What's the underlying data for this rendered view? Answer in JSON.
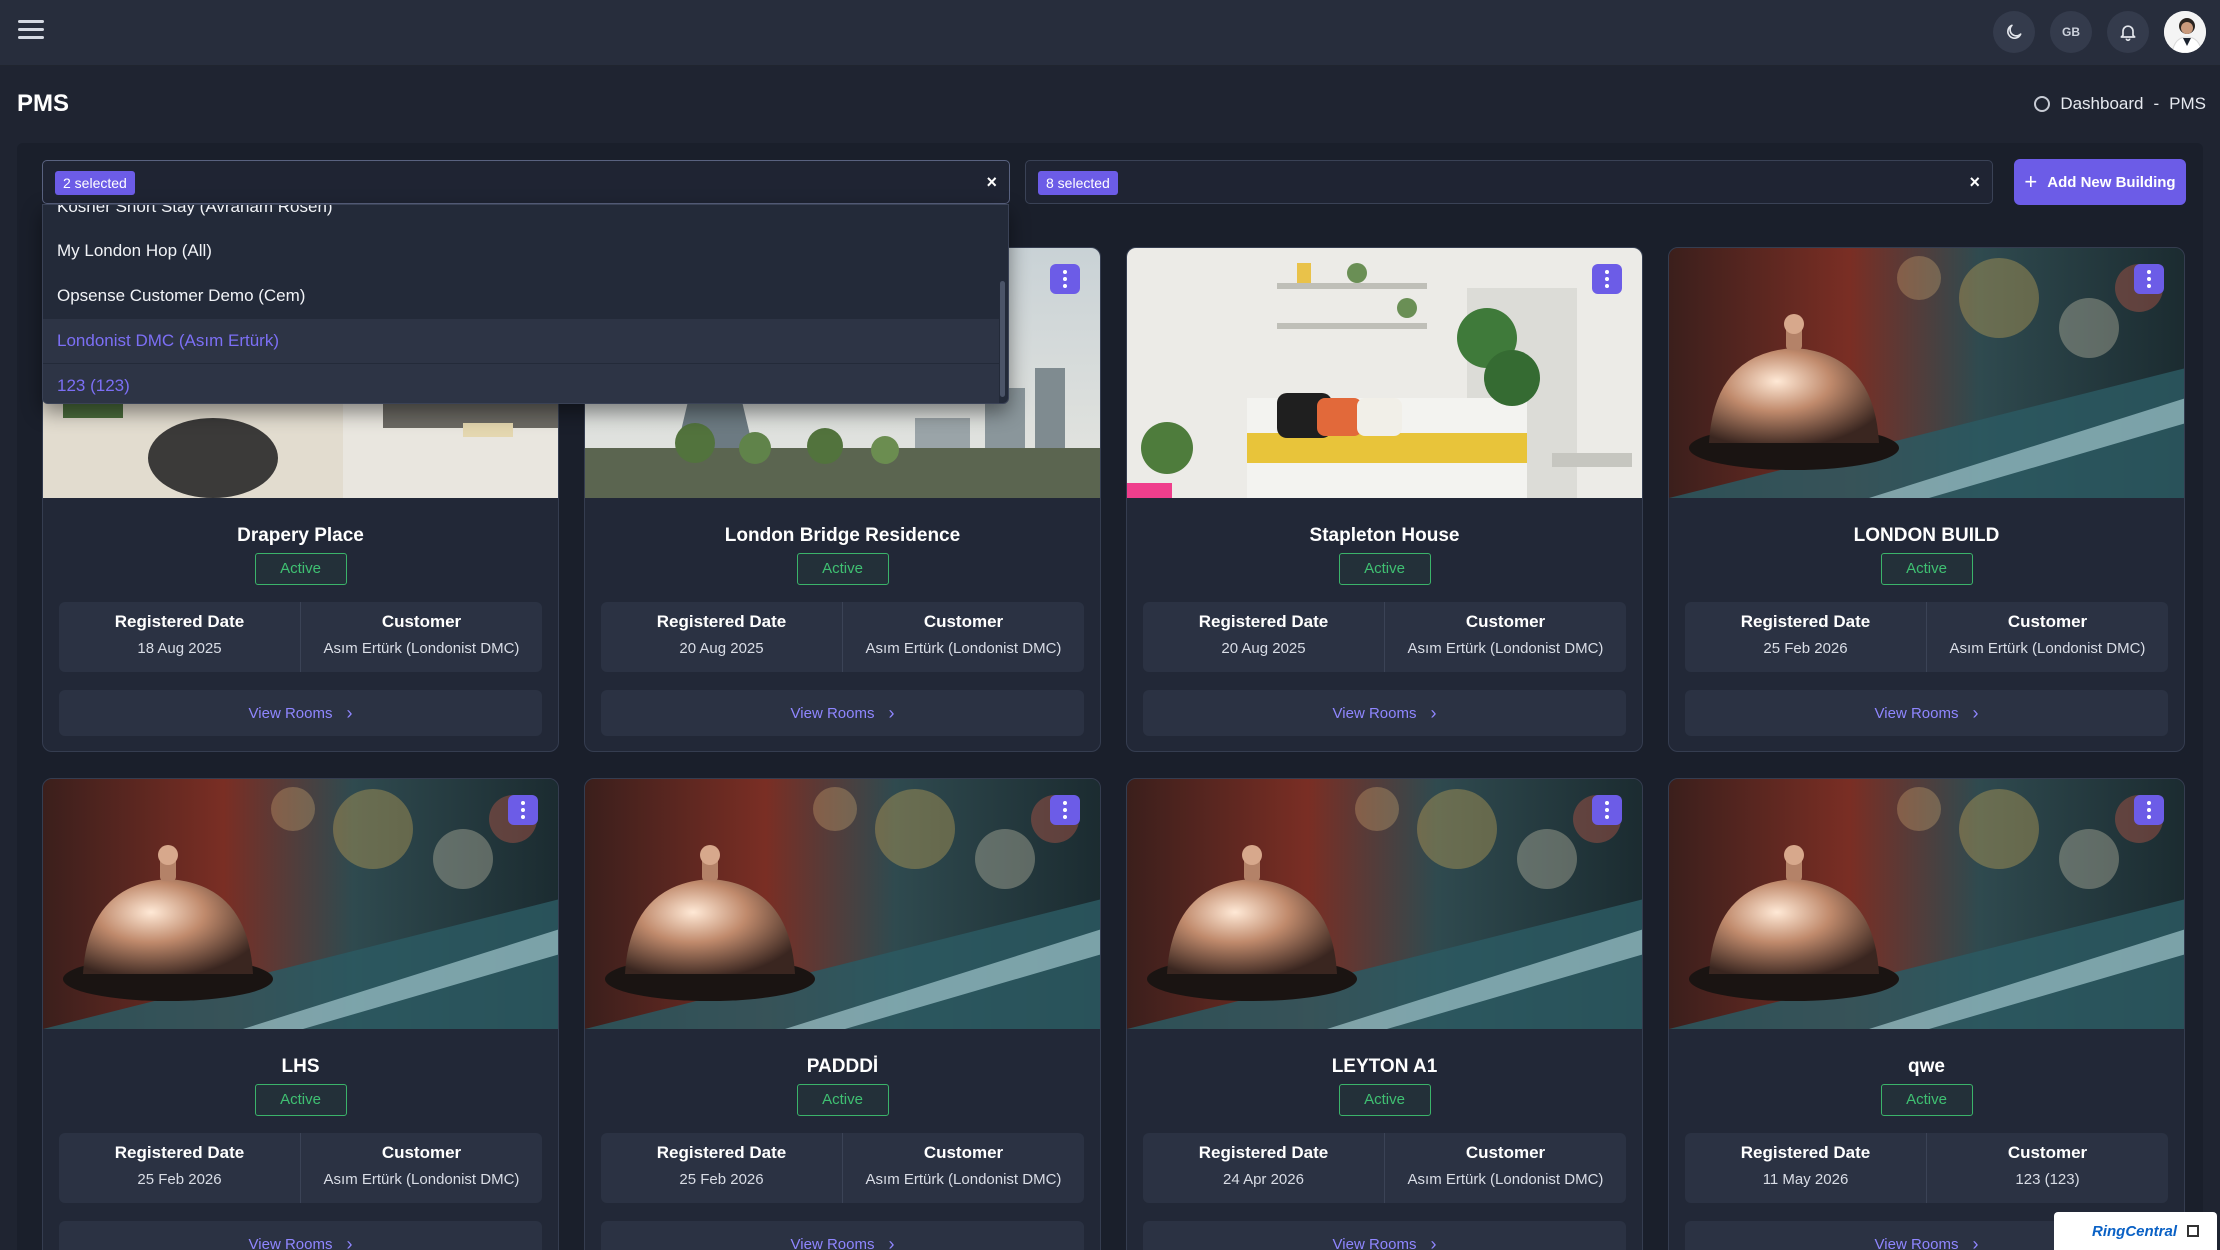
{
  "topbar": {
    "language_code": "GB",
    "icons": [
      "menu-icon",
      "theme-toggle-icon",
      "notification-bell-icon",
      "user-avatar"
    ]
  },
  "page": {
    "title": "PMS",
    "breadcrumb": {
      "home": "Dashboard",
      "separator": "-",
      "current": "PMS"
    }
  },
  "filters": {
    "customer_select": {
      "chip": "2 selected",
      "clear": "×"
    },
    "building_select": {
      "chip": "8 selected",
      "clear": "×"
    },
    "add_button": "Add New Building"
  },
  "dropdown": {
    "items": [
      {
        "label": "Kosher Short Stay (Avraham Rosen)",
        "selected": false
      },
      {
        "label": "My London Hop (All)",
        "selected": false
      },
      {
        "label": "Opsense Customer Demo (Cem)",
        "selected": false
      },
      {
        "label": "Londonist DMC (Asım Ertürk)",
        "selected": true
      },
      {
        "label": "123 (123)",
        "selected": true
      }
    ]
  },
  "card_labels": {
    "registered_date": "Registered Date",
    "customer": "Customer",
    "view_rooms": "View Rooms"
  },
  "buildings": [
    {
      "name": "Drapery Place",
      "status": "Active",
      "registered": "18 Aug 2025",
      "customer": "Asım Ertürk (Londonist DMC)",
      "image": "bedroom"
    },
    {
      "name": "London Bridge Residence",
      "status": "Active",
      "registered": "20 Aug 2025",
      "customer": "Asım Ertürk (Londonist DMC)",
      "image": "city-terrace"
    },
    {
      "name": "Stapleton House",
      "status": "Active",
      "registered": "20 Aug 2025",
      "customer": "Asım Ertürk (Londonist DMC)",
      "image": "bedroom-yellow"
    },
    {
      "name": "LONDON BUILD",
      "status": "Active",
      "registered": "25 Feb 2026",
      "customer": "Asım Ertürk (Londonist DMC)",
      "image": "reception-bell"
    },
    {
      "name": "LHS",
      "status": "Active",
      "registered": "25 Feb 2026",
      "customer": "Asım Ertürk (Londonist DMC)",
      "image": "reception-bell"
    },
    {
      "name": "PADDDİ",
      "status": "Active",
      "registered": "25 Feb 2026",
      "customer": "Asım Ertürk (Londonist DMC)",
      "image": "reception-bell"
    },
    {
      "name": "LEYTON A1",
      "status": "Active",
      "registered": "24 Apr 2026",
      "customer": "Asım Ertürk (Londonist DMC)",
      "image": "reception-bell"
    },
    {
      "name": "qwe",
      "status": "Active",
      "registered": "11 May 2026",
      "customer": "123 (123)",
      "image": "reception-bell"
    }
  ],
  "widget": {
    "label": "RingCentral"
  },
  "colors": {
    "accent": "#6c5ce7",
    "status_active": "#3fc072",
    "background": "#1f2431"
  }
}
